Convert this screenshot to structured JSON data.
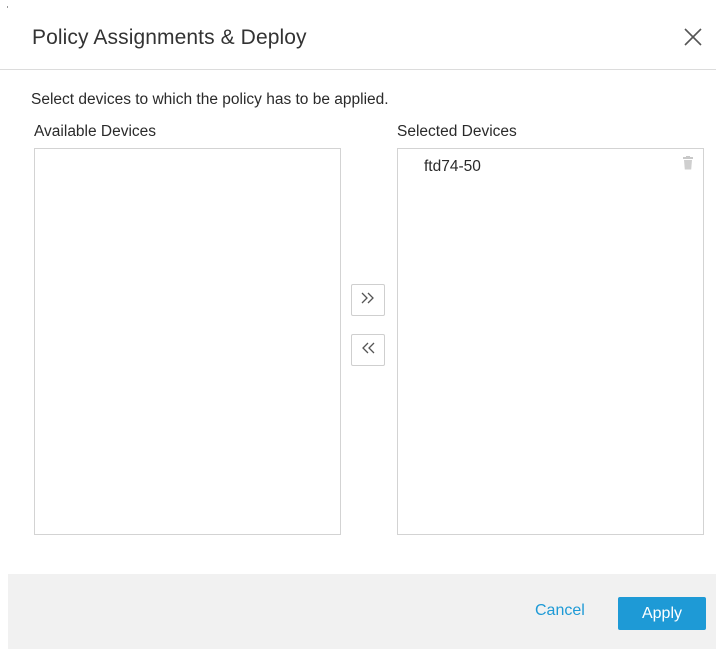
{
  "dialog": {
    "title": "Policy Assignments & Deploy",
    "close_icon": "close-icon"
  },
  "instruction": "Select devices to which the policy has to be applied.",
  "available": {
    "label": "Available Devices",
    "items": []
  },
  "selected": {
    "label": "Selected Devices",
    "items": [
      {
        "label": "ftd74-50",
        "icon": "trash-icon"
      }
    ]
  },
  "move_buttons": {
    "add_icon": "double-chevron-right-icon",
    "remove_icon": "double-chevron-left-icon"
  },
  "footer": {
    "cancel_label": "Cancel",
    "apply_label": "Apply"
  },
  "colors": {
    "accent": "#1e9ad6",
    "footer_bg": "#f1f1f1",
    "border": "#d3d3d3"
  }
}
